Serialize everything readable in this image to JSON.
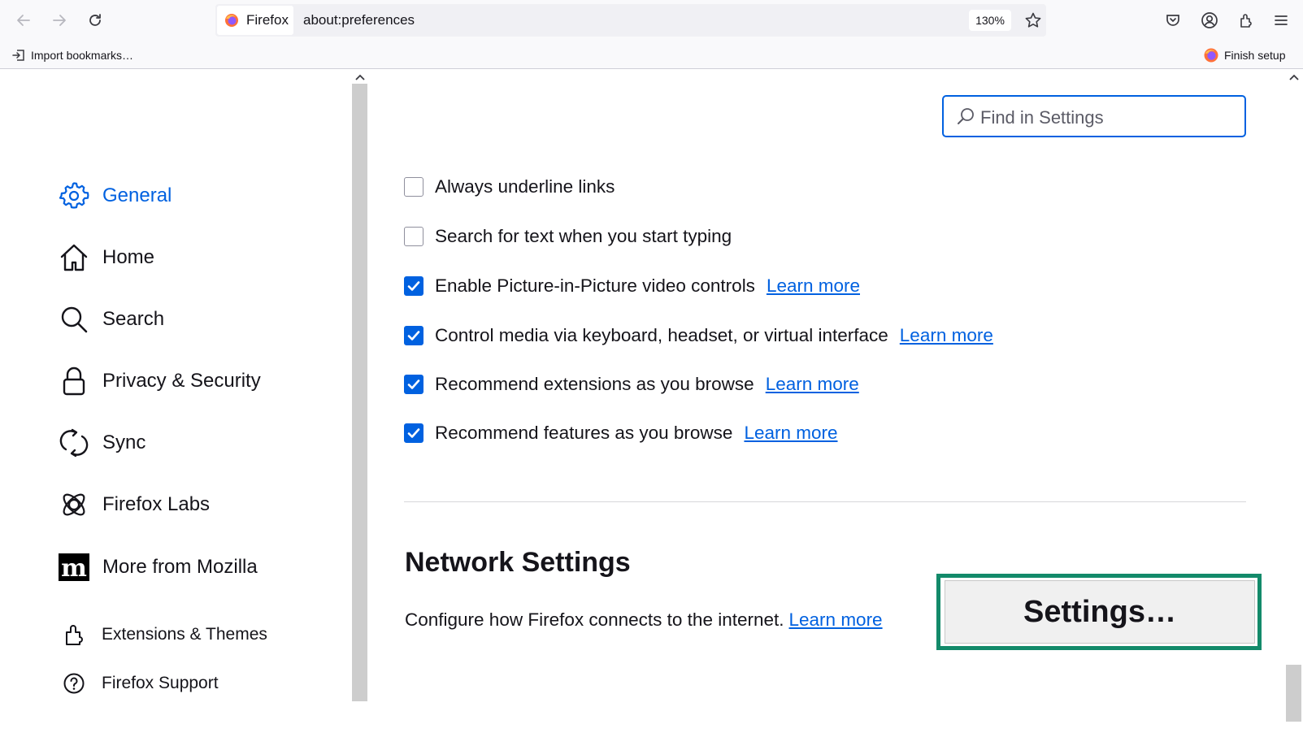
{
  "toolbar": {
    "identity_label": "Firefox",
    "url": "about:preferences",
    "zoom": "130%"
  },
  "bookmarks_bar": {
    "import_label": "Import bookmarks…",
    "finish_setup_label": "Finish setup"
  },
  "sidebar": {
    "items": [
      {
        "label": "General",
        "icon": "gear-icon",
        "selected": true
      },
      {
        "label": "Home",
        "icon": "home-icon"
      },
      {
        "label": "Search",
        "icon": "search-icon"
      },
      {
        "label": "Privacy & Security",
        "icon": "lock-icon"
      },
      {
        "label": "Sync",
        "icon": "sync-icon"
      },
      {
        "label": "Firefox Labs",
        "icon": "atom-icon"
      },
      {
        "label": "More from Mozilla",
        "icon": "mozilla-m-icon"
      }
    ],
    "footer": [
      {
        "label": "Extensions & Themes",
        "icon": "puzzle-icon"
      },
      {
        "label": "Firefox Support",
        "icon": "help-icon"
      }
    ]
  },
  "main": {
    "search_placeholder": "Find in Settings",
    "options": [
      {
        "label": "Always underline links",
        "checked": false
      },
      {
        "label": "Search for text when you start typing",
        "checked": false
      },
      {
        "label": "Enable Picture-in-Picture video controls",
        "checked": true,
        "link": "Learn more"
      },
      {
        "label": "Control media via keyboard, headset, or virtual interface",
        "checked": true,
        "link": "Learn more"
      },
      {
        "label": "Recommend extensions as you browse",
        "checked": true,
        "link": "Learn more"
      },
      {
        "label": "Recommend features as you browse",
        "checked": true,
        "link": "Learn more"
      }
    ],
    "network": {
      "heading": "Network Settings",
      "description": "Configure how Firefox connects to the internet.",
      "link": "Learn more",
      "button": "Settings…"
    }
  },
  "colors": {
    "accent": "#0061e0",
    "highlight_frame": "#138a6a"
  }
}
